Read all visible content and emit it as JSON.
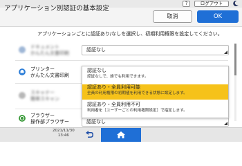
{
  "topbar": {
    "question_label": "?",
    "logout_label": "ログアウト"
  },
  "header": {
    "title": "アプリケーション別認証の基本設定",
    "cancel_label": "取消",
    "ok_label": "OK"
  },
  "instruction": "アプリケーションごとに認証あり/なしを選択し、初期利用権限を設定してください。",
  "rows": [
    {
      "label_line1": "ドキュメント",
      "label_line2": "かんたん文書印刷"
    },
    {
      "label_line1": "プリンター",
      "label_line2": "かんたん文書印刷",
      "value": "認証なし"
    },
    {
      "label_line1": "スキャナー",
      "label_line2": "簡単スキャン"
    },
    {
      "label_line1": "ブラウザー",
      "label_line2": "操作部ブラウザー",
      "value": "認証なし"
    }
  ],
  "first_select_value": "認証なし",
  "dropdown": {
    "options": [
      {
        "title": "認証なし",
        "desc": "認証なしで、誰でも利用できます。",
        "selected": false
      },
      {
        "title": "認証あり・全員利用可能",
        "desc": "全員の利用権限の初期値を利用できる状態に設定します。",
        "selected": true
      },
      {
        "title": "認証あり・全員利用不可",
        "desc": "利用者を［ユーザーごとの利用権限設定］で指定します。",
        "selected": false
      }
    ]
  },
  "footer": {
    "date": "2021/11/30",
    "time": "13:46"
  },
  "colors": {
    "accent": "#1f6fd6",
    "selected_option": "#f6c21a",
    "printer_icon": "#2f7fd8",
    "browser_icon": "#3a9a3a"
  },
  "icons": [
    "question-icon",
    "moon-icon",
    "printer-icon",
    "browser-icon",
    "back-arrow-icon",
    "home-icon",
    "select-corner-icon"
  ]
}
